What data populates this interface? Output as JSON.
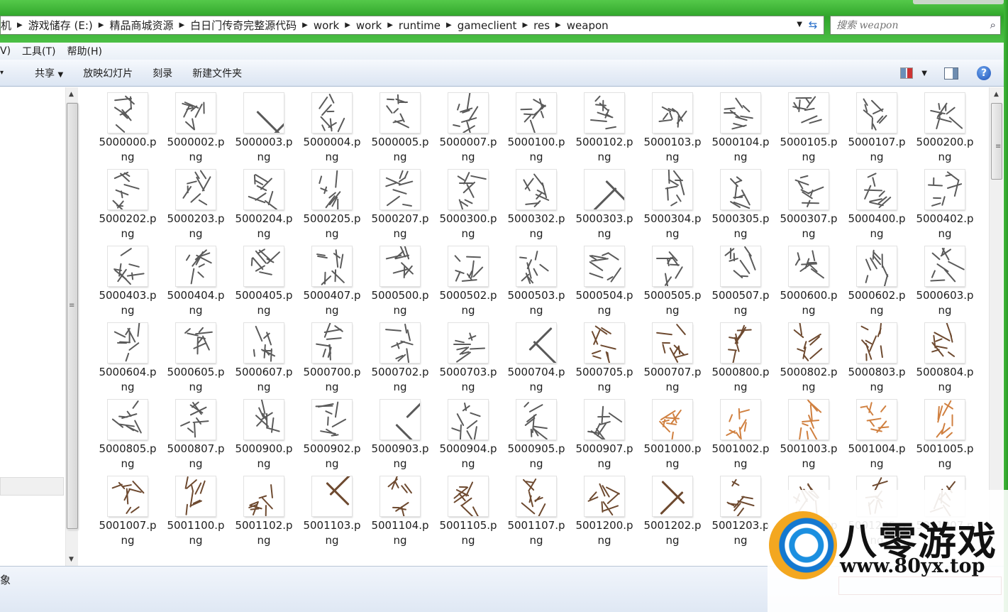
{
  "window": {
    "address": {
      "crumbs": [
        "机",
        "游戏储存 (E:)",
        "精品商城资源",
        "白日门传奇完整源代码",
        "work",
        "work",
        "runtime",
        "gameclient",
        "res",
        "weapon"
      ]
    },
    "search": {
      "placeholder": "搜索 weapon"
    }
  },
  "menubar": {
    "items": [
      "V)",
      "工具(T)",
      "帮助(H)"
    ]
  },
  "toolbar": {
    "partial": "▸",
    "share": "共享",
    "slideshow": "放映幻灯片",
    "burn": "刻录",
    "new_folder": "新建文件夹",
    "help": "?"
  },
  "files": [
    "5000000.png",
    "5000002.png",
    "5000003.png",
    "5000004.png",
    "5000005.png",
    "5000007.png",
    "5000100.png",
    "5000102.png",
    "5000103.png",
    "5000104.png",
    "5000105.png",
    "5000107.png",
    "5000200.png",
    "5000202.png",
    "5000203.png",
    "5000204.png",
    "5000205.png",
    "5000207.png",
    "5000300.png",
    "5000302.png",
    "5000303.png",
    "5000304.png",
    "5000305.png",
    "5000307.png",
    "5000400.png",
    "5000402.png",
    "5000403.png",
    "5000404.png",
    "5000405.png",
    "5000407.png",
    "5000500.png",
    "5000502.png",
    "5000503.png",
    "5000504.png",
    "5000505.png",
    "5000507.png",
    "5000600.png",
    "5000602.png",
    "5000603.png",
    "5000604.png",
    "5000605.png",
    "5000607.png",
    "5000700.png",
    "5000702.png",
    "5000703.png",
    "5000704.png",
    "5000705.png",
    "5000707.png",
    "5000800.png",
    "5000802.png",
    "5000803.png",
    "5000804.png",
    "5000805.png",
    "5000807.png",
    "5000900.png",
    "5000902.png",
    "5000903.png",
    "5000904.png",
    "5000905.png",
    "5000907.png",
    "5001000.png",
    "5001002.png",
    "5001003.png",
    "5001004.png",
    "5001005.png",
    "5001007.png",
    "5001100.png",
    "5001102.png",
    "5001103.png",
    "5001104.png",
    "5001105.png",
    "5001107.png",
    "5001200.png",
    "5001202.png",
    "5001203.png",
    "5001204.png",
    "5001205.png",
    "5001207.png"
  ],
  "thumb_colors": [
    "#5a5a5a",
    "#5a5a5a",
    "#5a5a5a",
    "#5a5a5a",
    "#5a5a5a",
    "#6e4a30",
    "#d08040"
  ],
  "statusbar": {
    "text": "象"
  },
  "watermark": {
    "title": "八零游戏",
    "url": "www.80yx.top"
  }
}
